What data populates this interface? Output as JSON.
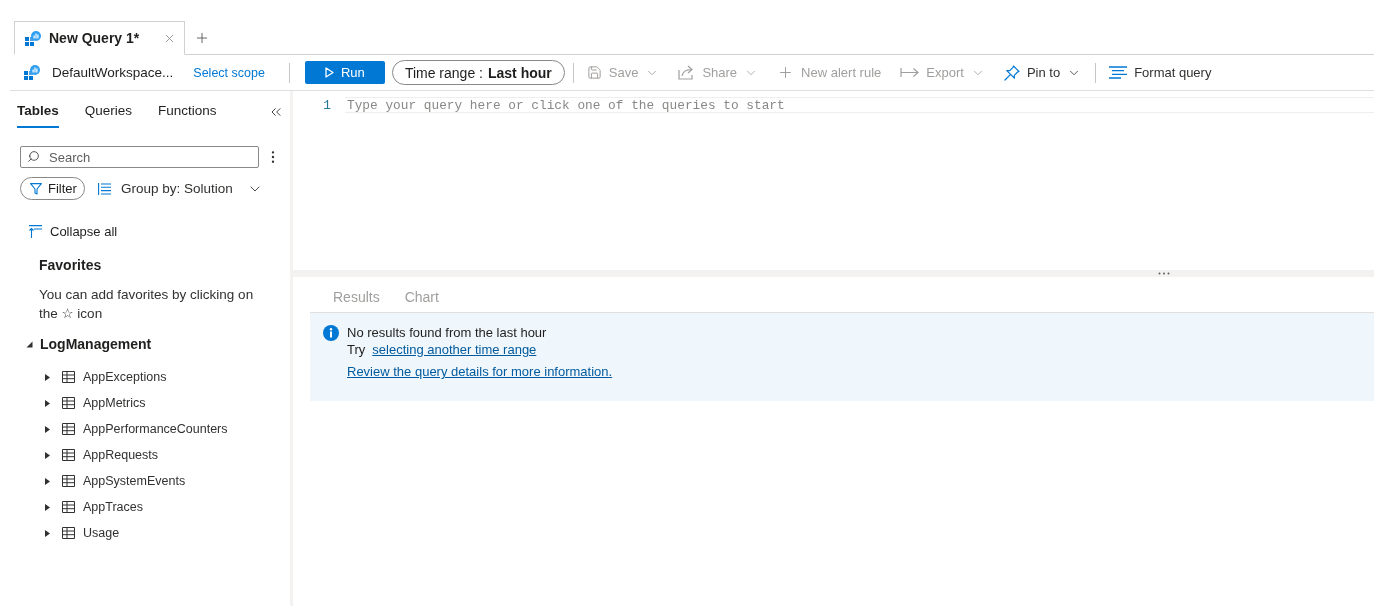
{
  "tabs": [
    {
      "label": "New Query 1*",
      "selected": true
    }
  ],
  "toolbar": {
    "workspace": "DefaultWorkspace...",
    "scope_link": "Select scope",
    "run_button": "Run",
    "time_range": {
      "label": "Time range :",
      "value": "Last hour"
    },
    "actions": [
      {
        "label": "Save",
        "disabled": true,
        "dropdown": true
      },
      {
        "label": "Share",
        "disabled": true,
        "dropdown": true
      },
      {
        "label": "New alert rule",
        "disabled": true,
        "dropdown": false
      },
      {
        "label": "Export",
        "disabled": true,
        "dropdown": true
      },
      {
        "label": "Pin to",
        "disabled": false,
        "dropdown": true
      }
    ],
    "format_button": "Format query"
  },
  "sidebar": {
    "tabs": [
      {
        "label": "Tables",
        "selected": true
      },
      {
        "label": "Queries",
        "selected": false
      },
      {
        "label": "Functions",
        "selected": false
      }
    ],
    "search": {
      "placeholder": "Search"
    },
    "filter_button": "Filter",
    "group_by": "Group by: Solution",
    "collapse_all": "Collapse all",
    "favorites": {
      "title": "Favorites",
      "hint": "You can add favorites by clicking on the ☆ icon"
    },
    "tree": [
      {
        "label": "LogManagement",
        "expanded": true,
        "children": [
          {
            "label": "AppExceptions",
            "expanded": false
          },
          {
            "label": "AppMetrics",
            "expanded": false
          },
          {
            "label": "AppPerformanceCounters",
            "expanded": false
          },
          {
            "label": "AppRequests",
            "expanded": false
          },
          {
            "label": "AppSystemEvents",
            "expanded": false
          },
          {
            "label": "AppTraces",
            "expanded": false
          },
          {
            "label": "Usage",
            "expanded": false
          }
        ]
      }
    ]
  },
  "editor": {
    "lines": [
      {
        "number": "1",
        "placeholder": "Type your query here or click one of the queries to start"
      }
    ]
  },
  "results": {
    "tabs": [
      {
        "label": "Results",
        "disabled": true
      },
      {
        "label": "Chart",
        "disabled": true
      }
    ],
    "message": {
      "title": "No results found from the last hour",
      "try_prefix": "Try",
      "try_link": "selecting another time range",
      "details_link": "Review the query details for more information."
    }
  }
}
